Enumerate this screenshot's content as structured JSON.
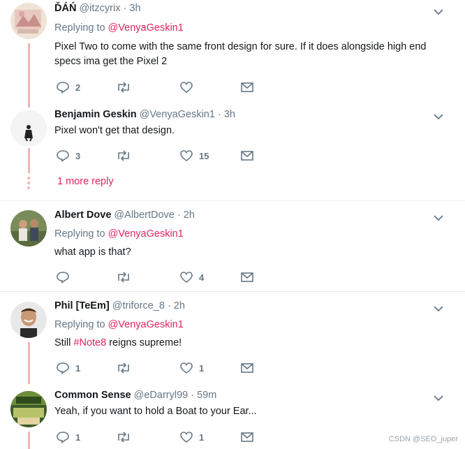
{
  "tweets": [
    {
      "name": "ĎÁŃ",
      "handle": "@itzcyrix",
      "time": "3h",
      "replying_label": "Replying to",
      "replying_to": "@VenyaGeskin1",
      "text": "Pixel Two to come with the same front design for sure. If it does alongside high end specs ima get the Pixel 2",
      "reply_count": "2",
      "retweet_count": "",
      "like_count": ""
    },
    {
      "name": "Benjamin Geskin",
      "handle": "@VenyaGeskin1",
      "time": "3h",
      "text": "Pixel won't get that design.",
      "reply_count": "3",
      "retweet_count": "",
      "like_count": "15",
      "more_replies": "1 more reply"
    },
    {
      "name": "Albert Dove",
      "handle": "@AlbertDove",
      "time": "2h",
      "replying_label": "Replying to",
      "replying_to": "@VenyaGeskin1",
      "text": "what app is that?",
      "reply_count": "",
      "retweet_count": "",
      "like_count": "4"
    },
    {
      "name": "Phil [TeEm]",
      "handle": "@triforce_8",
      "time": "2h",
      "replying_label": "Replying to",
      "replying_to": "@VenyaGeskin1",
      "text_before": "Still ",
      "hashtag": "#Note8",
      "text_after": " reigns supreme!",
      "reply_count": "1",
      "retweet_count": "",
      "like_count": "1"
    },
    {
      "name": "Common Sense",
      "handle": "@eDarryl99",
      "time": "59m",
      "text": "Yeah, if you want to hold a Boat to your Ear...",
      "reply_count": "1",
      "retweet_count": "",
      "like_count": "1"
    }
  ],
  "separator": "·",
  "watermark": "CSDN @SEO_juper",
  "colors": {
    "accent": "#e0245e",
    "muted": "#657786",
    "thread": "#f3b4b4",
    "divider": "#e6ecf0"
  },
  "icons": [
    "reply-icon",
    "retweet-icon",
    "like-icon",
    "message-icon",
    "chevron-down-icon"
  ]
}
